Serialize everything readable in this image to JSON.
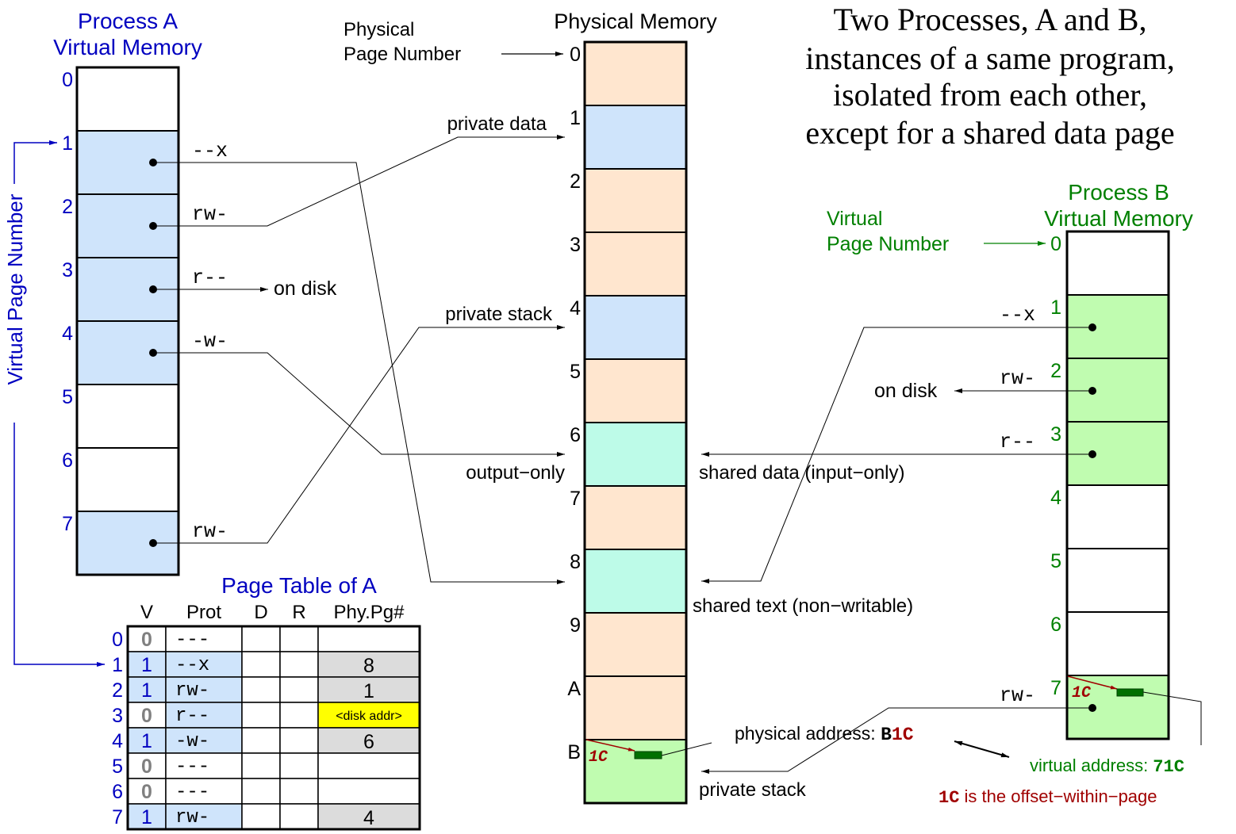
{
  "title_lines": [
    "Two Processes, A and B,",
    "instances of a same program,",
    "isolated from each other,",
    "except for a shared data page"
  ],
  "colors": {
    "process_a": "#0000c0",
    "process_b": "#008000",
    "page_blue": "#cfe4fb",
    "page_peach": "#ffe6cf",
    "page_cyan": "#bdfbe8",
    "page_green": "#c0fcb0",
    "cell_grey": "#dcdcdc",
    "disk_yellow": "#ffff00",
    "offset_red": "#a00000",
    "byte_marker": "#007000"
  },
  "process_a": {
    "title_line1": "Process A",
    "title_line2": "Virtual Memory",
    "axis_label": "Virtual Page Number",
    "pages": [
      {
        "num": "0",
        "mapped": false,
        "prot": ""
      },
      {
        "num": "1",
        "mapped": true,
        "prot": "--x"
      },
      {
        "num": "2",
        "mapped": true,
        "prot": "rw-"
      },
      {
        "num": "3",
        "mapped": true,
        "prot": "r--"
      },
      {
        "num": "4",
        "mapped": true,
        "prot": "-w-"
      },
      {
        "num": "5",
        "mapped": false,
        "prot": ""
      },
      {
        "num": "6",
        "mapped": false,
        "prot": ""
      },
      {
        "num": "7",
        "mapped": true,
        "prot": "rw-"
      }
    ],
    "on_disk_label": "on disk"
  },
  "page_table": {
    "title": "Page Table of A",
    "headers": [
      "V",
      "Prot",
      "D",
      "R",
      "Phy.Pg#"
    ],
    "rows": [
      {
        "idx": "0",
        "v": "0",
        "prot": "---",
        "d": "",
        "r": "",
        "phy": "",
        "phy_kind": "none"
      },
      {
        "idx": "1",
        "v": "1",
        "prot": "--x",
        "d": "",
        "r": "",
        "phy": "8",
        "phy_kind": "page"
      },
      {
        "idx": "2",
        "v": "1",
        "prot": "rw-",
        "d": "",
        "r": "",
        "phy": "1",
        "phy_kind": "page"
      },
      {
        "idx": "3",
        "v": "0",
        "prot": "r--",
        "d": "",
        "r": "",
        "phy": "<disk addr>",
        "phy_kind": "disk"
      },
      {
        "idx": "4",
        "v": "1",
        "prot": "-w-",
        "d": "",
        "r": "",
        "phy": "6",
        "phy_kind": "page"
      },
      {
        "idx": "5",
        "v": "0",
        "prot": "---",
        "d": "",
        "r": "",
        "phy": "",
        "phy_kind": "none"
      },
      {
        "idx": "6",
        "v": "0",
        "prot": "---",
        "d": "",
        "r": "",
        "phy": "",
        "phy_kind": "none"
      },
      {
        "idx": "7",
        "v": "1",
        "prot": "rw-",
        "d": "",
        "r": "",
        "phy": "4",
        "phy_kind": "page"
      }
    ]
  },
  "physical_memory": {
    "title": "Physical Memory",
    "axis_label_line1": "Physical",
    "axis_label_line2": "Page Number",
    "pages": [
      {
        "num": "0",
        "kind": "peach"
      },
      {
        "num": "1",
        "kind": "blue"
      },
      {
        "num": "2",
        "kind": "peach"
      },
      {
        "num": "3",
        "kind": "peach"
      },
      {
        "num": "4",
        "kind": "blue"
      },
      {
        "num": "5",
        "kind": "peach"
      },
      {
        "num": "6",
        "kind": "cyan"
      },
      {
        "num": "7",
        "kind": "peach"
      },
      {
        "num": "8",
        "kind": "cyan"
      },
      {
        "num": "9",
        "kind": "peach"
      },
      {
        "num": "A",
        "kind": "peach"
      },
      {
        "num": "B",
        "kind": "green"
      }
    ],
    "labels": {
      "private_data": "private data",
      "private_stack_a": "private stack",
      "output_only": "output−only",
      "shared_data": "shared data (input−only)",
      "shared_text": "shared text (non−writable)",
      "private_stack_b": "private stack"
    }
  },
  "process_b": {
    "title_line1": "Process B",
    "title_line2": "Virtual Memory",
    "axis_label_line1": "Virtual",
    "axis_label_line2": "Page Number",
    "pages": [
      {
        "num": "0",
        "mapped": false,
        "prot": ""
      },
      {
        "num": "1",
        "mapped": true,
        "prot": "--x"
      },
      {
        "num": "2",
        "mapped": true,
        "prot": "rw-"
      },
      {
        "num": "3",
        "mapped": true,
        "prot": "r--"
      },
      {
        "num": "4",
        "mapped": false,
        "prot": ""
      },
      {
        "num": "5",
        "mapped": false,
        "prot": ""
      },
      {
        "num": "6",
        "mapped": false,
        "prot": ""
      },
      {
        "num": "7",
        "mapped": true,
        "prot": "rw-"
      }
    ],
    "on_disk_label": "on disk"
  },
  "address_example": {
    "offset": "1C",
    "physical_label": "physical address: ",
    "physical_page": "B",
    "physical_offset": "1C",
    "virtual_label": "virtual address: ",
    "virtual_value": "71C",
    "footnote_code": "1C",
    "footnote_text": " is the offset−within−page"
  }
}
